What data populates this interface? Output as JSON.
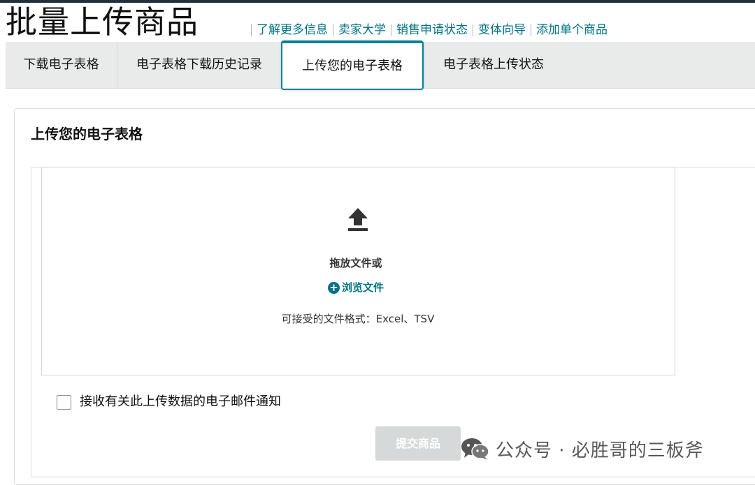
{
  "page": {
    "title": "批量上传商品"
  },
  "header_links": [
    {
      "label": "了解更多信息"
    },
    {
      "label": "卖家大学"
    },
    {
      "label": "销售申请状态"
    },
    {
      "label": "变体向导"
    },
    {
      "label": "添加单个商品"
    }
  ],
  "tabs": [
    {
      "label": "下载电子表格"
    },
    {
      "label": "电子表格下载历史记录"
    },
    {
      "label": "上传您的电子表格",
      "active": true
    },
    {
      "label": "电子表格上传状态"
    }
  ],
  "upload": {
    "section_title": "上传您的电子表格",
    "icon": "upload-icon",
    "drag_text": "拖放文件或",
    "browse_label": "浏览文件",
    "browse_icon": "plus-circle-icon",
    "formats": "可接受的文件格式：Excel、TSV"
  },
  "notify": {
    "label": "接收有关此上传数据的电子邮件通知",
    "checked": false
  },
  "submit": {
    "label": "提交商品",
    "enabled": false
  },
  "watermark": {
    "icon": "wechat-icon",
    "text": "公众号 · 必胜哥的三板斧"
  },
  "colors": {
    "link": "#007185",
    "active_tab_border": "#008296",
    "tab_bar_bg": "#e9eaea",
    "disabled_button": "#d5d9d9"
  }
}
